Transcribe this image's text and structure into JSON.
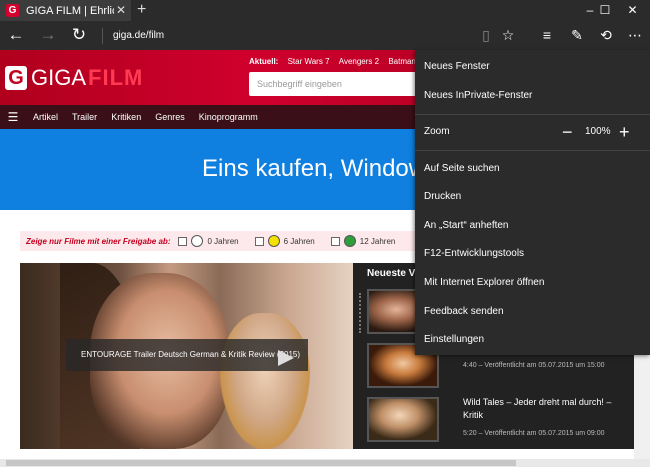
{
  "tab": {
    "title": "GIGA FILM | Ehrlich, leid",
    "favicon": "G"
  },
  "window": {
    "minimize": "–",
    "maximize": "☐",
    "close": "✕"
  },
  "address": {
    "url": "giga.de/film"
  },
  "site": {
    "logo_g": "G",
    "logo_giga": "GIGA",
    "logo_film": "FILM",
    "aktuell_label": "Aktuell:",
    "aktuell_items": [
      "Star Wars 7",
      "Avengers 2",
      "Batman VS Sup"
    ],
    "search_placeholder": "Suchbegriff eingeben",
    "nav": [
      "Artikel",
      "Trailer",
      "Kritiken",
      "Genres",
      "Kinoprogramm"
    ],
    "banner_text": "Eins kaufen, Windows",
    "filter": {
      "label": "Zeige nur Filme mit einer Freigabe ab:",
      "options": [
        {
          "label": "0 Jahren",
          "color": "#ffffff"
        },
        {
          "label": "6 Jahren",
          "color": "#f5e000"
        },
        {
          "label": "12 Jahren",
          "color": "#2e9e3a"
        }
      ]
    },
    "main_video": {
      "caption": "ENTOURAGE Trailer Deutsch German & Kritik Review (2015)"
    },
    "newest": {
      "heading": "Neueste Vi",
      "items": [
        {
          "title": "",
          "meta": ""
        },
        {
          "title": "",
          "meta": "4:40 – Veröffentlicht am 05.07.2015 um 15:00"
        },
        {
          "title": "Wild Tales – Jeder dreht mal durch! – Kritik",
          "meta": "5:20 – Veröffentlicht am 05.07.2015 um 09:00"
        }
      ]
    }
  },
  "menu": {
    "new_window": "Neues Fenster",
    "new_inprivate": "Neues InPrivate-Fenster",
    "zoom_label": "Zoom",
    "zoom_value": "100%",
    "find_on_page": "Auf Seite suchen",
    "print": "Drucken",
    "pin_start": "An „Start“ anheften",
    "f12_tools": "F12-Entwicklungstools",
    "open_ie": "Mit Internet Explorer öffnen",
    "feedback": "Feedback senden",
    "settings": "Einstellungen"
  }
}
